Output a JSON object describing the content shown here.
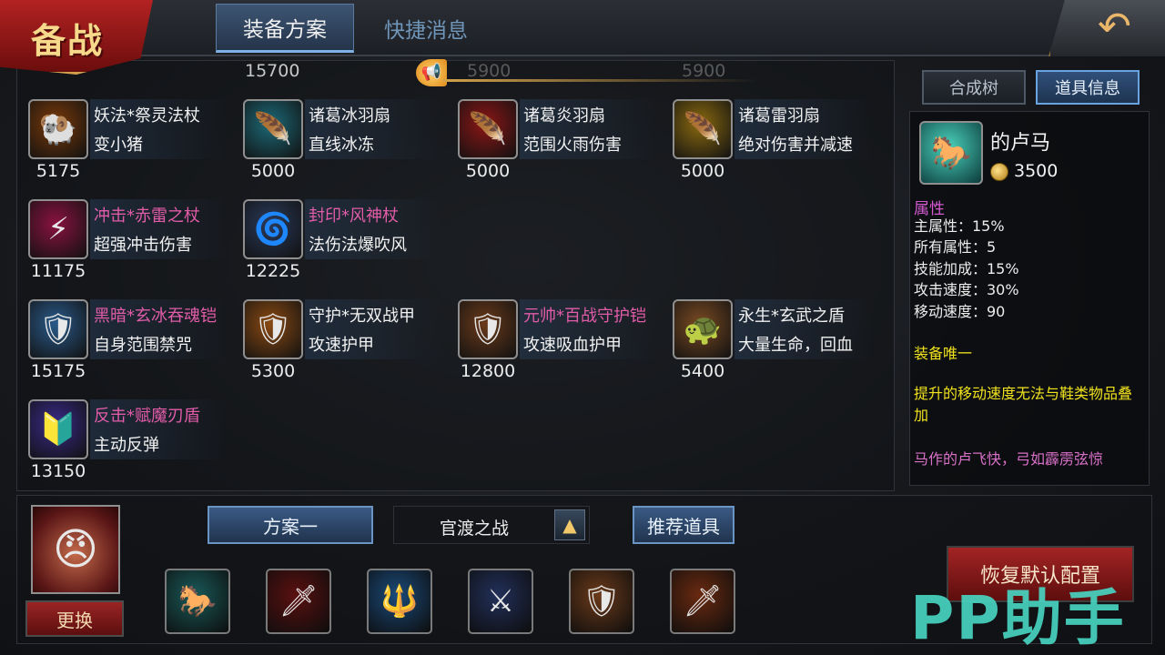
{
  "header": {
    "brand": "备战",
    "tabs": [
      {
        "label": "装备方案",
        "active": true
      },
      {
        "label": "快捷消息",
        "active": false
      }
    ],
    "back_icon": "back-arrow-icon"
  },
  "scrolled_row": {
    "price_1": "15700",
    "price_2": "5900",
    "price_3": "5900"
  },
  "items": [
    {
      "name": "妖法*祭灵法杖",
      "desc": "变小猪",
      "price": "5175",
      "name_color": "white",
      "icon": "ram-skull-staff-icon",
      "glyph": "🐏",
      "bg": "#7a3a0a"
    },
    {
      "name": "诸葛冰羽扇",
      "desc": "直线冰冻",
      "price": "5000",
      "name_color": "white",
      "icon": "ice-feather-fan-icon",
      "glyph": "🪶",
      "bg": "#1c6a78"
    },
    {
      "name": "诸葛炎羽扇",
      "desc": "范围火雨伤害",
      "price": "5000",
      "name_color": "white",
      "icon": "fire-feather-fan-icon",
      "glyph": "🪶",
      "bg": "#8c1616"
    },
    {
      "name": "诸葛雷羽扇",
      "desc": "绝对伤害并减速",
      "price": "5000",
      "name_color": "white",
      "icon": "thunder-feather-fan-icon",
      "glyph": "🪶",
      "bg": "#8a6a10"
    },
    {
      "name": "冲击*赤雷之杖",
      "desc": "超强冲击伤害",
      "price": "11175",
      "name_color": "pink",
      "icon": "red-thunder-staff-icon",
      "glyph": "⚡",
      "bg": "#8a1240"
    },
    {
      "name": "封印*风神杖",
      "desc": "法伤法爆吹风",
      "price": "12225",
      "name_color": "pink",
      "icon": "wind-god-staff-icon",
      "glyph": "🌀",
      "bg": "#2a3a5a"
    },
    {
      "name": "黑暗*玄冰吞魂铠",
      "desc": "自身范围禁咒",
      "price": "15175",
      "name_color": "pink",
      "icon": "ice-soul-armor-icon",
      "glyph": "🛡",
      "bg": "#2a5a8a"
    },
    {
      "name": "守护*无双战甲",
      "desc": "攻速护甲",
      "price": "5300",
      "name_color": "white",
      "icon": "war-armor-icon",
      "glyph": "🛡",
      "bg": "#8a4a12"
    },
    {
      "name": "元帅*百战守护铠",
      "desc": "攻速吸血护甲",
      "price": "12800",
      "name_color": "pink",
      "icon": "marshal-armor-icon",
      "glyph": "🛡",
      "bg": "#6a3a1a"
    },
    {
      "name": "永生*玄武之盾",
      "desc": "大量生命，回血",
      "price": "5400",
      "name_color": "white",
      "icon": "tortoise-shield-icon",
      "glyph": "🐢",
      "bg": "#7a4a22"
    },
    {
      "name": "反击*赋魔刃盾",
      "desc": "主动反弹",
      "price": "13150",
      "name_color": "pink",
      "icon": "magic-blade-shield-icon",
      "glyph": "🔰",
      "bg": "#3a2a8a"
    }
  ],
  "right_panel": {
    "tabs": [
      {
        "label": "合成树",
        "active": false
      },
      {
        "label": "道具信息",
        "active": true
      }
    ],
    "item_name": "的卢马",
    "item_price": "3500",
    "item_icon": "white-horse-icon",
    "attr_title": "属性",
    "attributes": [
      "主属性：15%",
      "所有属性：5",
      "技能加成：15%",
      "攻击速度：30%",
      "移动速度：90"
    ],
    "unique_title": "装备唯一",
    "unique_desc": "提升的移动速度无法与鞋类物品叠加",
    "flavor": "马作的卢飞快，弓如霹雳弦惊"
  },
  "bottom": {
    "change_label": "更换",
    "hero_icon": "hero-portrait-icon",
    "plan_label": "方案一",
    "battle_select": "官渡之战",
    "up_arrow_icon": "up-arrow-icon",
    "recommend_label": "推荐道具",
    "reset_label": "恢复默认配置",
    "slots": [
      {
        "icon": "white-horse-icon",
        "glyph": "🐎",
        "bg": "#1a5a5a"
      },
      {
        "icon": "red-sword-icon",
        "glyph": "🗡",
        "bg": "#5a1010"
      },
      {
        "icon": "blue-spear-icon",
        "glyph": "🔱",
        "bg": "#1a4a7a"
      },
      {
        "icon": "crossed-blades-icon",
        "glyph": "⚔",
        "bg": "#22305a"
      },
      {
        "icon": "marshal-armor-icon",
        "glyph": "🛡",
        "bg": "#6a3a1a"
      },
      {
        "icon": "golden-blade-icon",
        "glyph": "🗡",
        "bg": "#6a2a10"
      }
    ]
  },
  "watermark": "PP助手"
}
